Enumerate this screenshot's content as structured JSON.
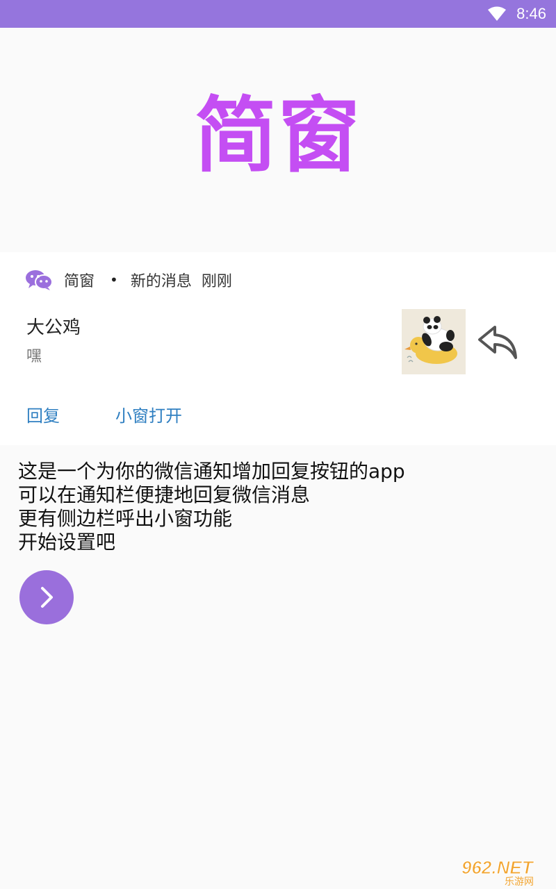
{
  "status_bar": {
    "time": "8:46",
    "wifi_icon": "wifi-icon",
    "bg_color": "#9575dd"
  },
  "app": {
    "title": "简窗",
    "title_color": "#c44ef3"
  },
  "notification": {
    "app_icon": "wechat-icon",
    "app_name": "简窗",
    "separator": "•",
    "kind": "新的消息",
    "time": "刚刚",
    "sender": "大公鸡",
    "message": "嘿",
    "avatar": "panda-duck-avatar",
    "reply_icon": "reply-arrow-icon",
    "actions": {
      "reply": "回复",
      "open_window": "小窗打开"
    },
    "action_color": "#2f7fc1"
  },
  "description": {
    "lines": [
      "这是一个为你的微信通知增加回复按钮的app",
      "可以在通知栏便捷地回复微信消息",
      "更有侧边栏呼出小窗功能",
      "开始设置吧"
    ]
  },
  "next_button": {
    "icon": "chevron-right-icon",
    "color": "#9a6fdc"
  },
  "watermark": {
    "brand": "962.NET",
    "site": "乐游网"
  }
}
